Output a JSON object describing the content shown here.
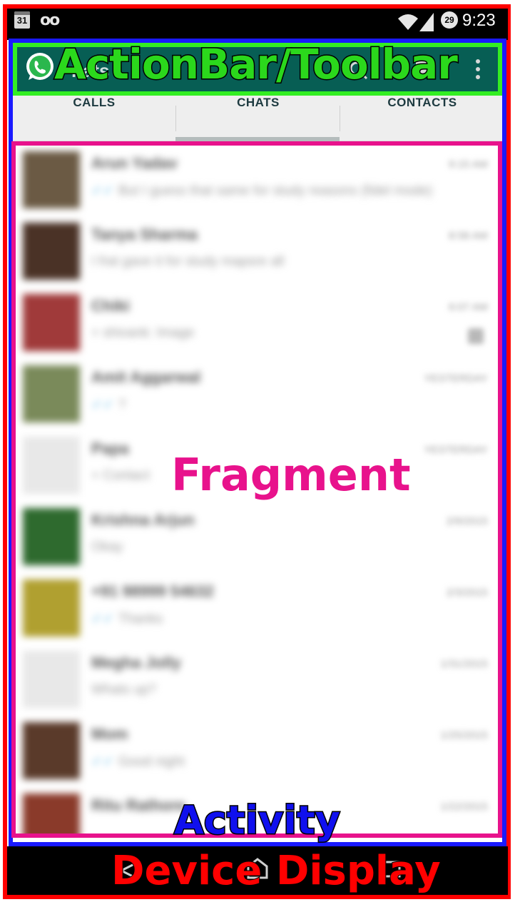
{
  "status_bar": {
    "calendar_day": "31",
    "voicemail_glyph": "oo",
    "notification_badge": "29",
    "time": "9:23",
    "icons": [
      "calendar-icon",
      "voicemail-icon",
      "wifi-icon",
      "signal-icon",
      "badge-icon"
    ]
  },
  "action_bar": {
    "title_fragment": "hats",
    "overlay_label": "ActionBar/Toolbar",
    "icons": [
      "whatsapp-logo-icon",
      "search-icon",
      "new-chat-icon",
      "overflow-menu-icon"
    ],
    "colors": {
      "background": "#075e54",
      "frame": "#33ee22"
    }
  },
  "tabs": [
    {
      "label": "CALLS",
      "selected": false
    },
    {
      "label": "CHATS",
      "selected": true
    },
    {
      "label": "CONTACTS",
      "selected": false
    }
  ],
  "fragment": {
    "label": "Fragment",
    "color": "#e8128c",
    "chats": [
      {
        "name": "Arun Yadav",
        "time": "9:15 AM",
        "message": "But I guess that same for study reasons (fidel mode)",
        "tick": true,
        "avatar_color": "#6b5a44"
      },
      {
        "name": "Tanya Sharma",
        "time": "8:58 AM",
        "message": "I frat gave it for study mapsre all",
        "tick": false,
        "avatar_color": "#4a3226"
      },
      {
        "name": "Chiki",
        "time": "6:07 AM",
        "message": "+ shivank: Image",
        "tick": false,
        "avatar_color": "#a03a3a",
        "muted": true
      },
      {
        "name": "Amit Aggarwal",
        "time": "YESTERDAY",
        "message": "?",
        "tick": true,
        "avatar_color": "#7a8a5a"
      },
      {
        "name": "Papa",
        "time": "YESTERDAY",
        "message": "+ Contact",
        "tick": false,
        "avatar_color": "#e8e8e8"
      },
      {
        "name": "Krishna Arjun",
        "time": "2/9/2015",
        "message": "Okay",
        "tick": false,
        "avatar_color": "#2e6a2e"
      },
      {
        "name": "+91 98999 54632",
        "time": "2/3/2015",
        "message": "Thanks",
        "tick": true,
        "avatar_color": "#b0a030"
      },
      {
        "name": "Megha Jolly",
        "time": "1/31/2015",
        "message": "Whats up?",
        "tick": false,
        "avatar_color": "#e8e8e8"
      },
      {
        "name": "Mom",
        "time": "1/25/2015",
        "message": "Good night",
        "tick": true,
        "avatar_color": "#5a3a2a"
      },
      {
        "name": "Ritu Rathore",
        "time": "1/22/2015",
        "message": "",
        "tick": false,
        "avatar_color": "#8a3a2a"
      }
    ]
  },
  "activity": {
    "label": "Activity",
    "color": "#1010ee"
  },
  "device": {
    "label": "Device Display",
    "color": "#ff0000"
  },
  "nav_bar": {
    "icons": [
      "back-icon",
      "home-icon",
      "recents-icon"
    ]
  }
}
